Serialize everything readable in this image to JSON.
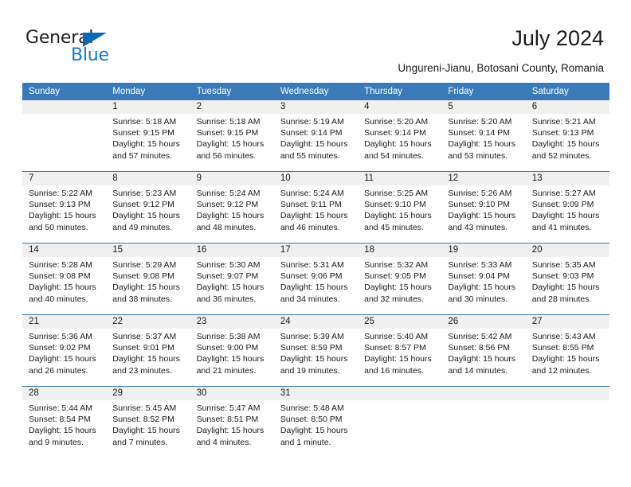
{
  "brand": {
    "name_part1": "General",
    "name_part2": "Blue",
    "triangle_icon": "triangle-icon",
    "accent_color": "#1878c4"
  },
  "header": {
    "title": "July 2024",
    "location": "Ungureni-Jianu, Botosani County, Romania"
  },
  "theme": {
    "header_blue": "#3a7ab8",
    "daynum_band": "#f0f0f0",
    "text": "#1a1a1a"
  },
  "calendar": {
    "weekday_headers": [
      "Sunday",
      "Monday",
      "Tuesday",
      "Wednesday",
      "Thursday",
      "Friday",
      "Saturday"
    ],
    "weeks": [
      {
        "days": [
          {
            "num": "",
            "lines": []
          },
          {
            "num": "1",
            "lines": [
              "Sunrise: 5:18 AM",
              "Sunset: 9:15 PM",
              "Daylight: 15 hours",
              "and 57 minutes."
            ]
          },
          {
            "num": "2",
            "lines": [
              "Sunrise: 5:18 AM",
              "Sunset: 9:15 PM",
              "Daylight: 15 hours",
              "and 56 minutes."
            ]
          },
          {
            "num": "3",
            "lines": [
              "Sunrise: 5:19 AM",
              "Sunset: 9:14 PM",
              "Daylight: 15 hours",
              "and 55 minutes."
            ]
          },
          {
            "num": "4",
            "lines": [
              "Sunrise: 5:20 AM",
              "Sunset: 9:14 PM",
              "Daylight: 15 hours",
              "and 54 minutes."
            ]
          },
          {
            "num": "5",
            "lines": [
              "Sunrise: 5:20 AM",
              "Sunset: 9:14 PM",
              "Daylight: 15 hours",
              "and 53 minutes."
            ]
          },
          {
            "num": "6",
            "lines": [
              "Sunrise: 5:21 AM",
              "Sunset: 9:13 PM",
              "Daylight: 15 hours",
              "and 52 minutes."
            ]
          }
        ]
      },
      {
        "days": [
          {
            "num": "7",
            "lines": [
              "Sunrise: 5:22 AM",
              "Sunset: 9:13 PM",
              "Daylight: 15 hours",
              "and 50 minutes."
            ]
          },
          {
            "num": "8",
            "lines": [
              "Sunrise: 5:23 AM",
              "Sunset: 9:12 PM",
              "Daylight: 15 hours",
              "and 49 minutes."
            ]
          },
          {
            "num": "9",
            "lines": [
              "Sunrise: 5:24 AM",
              "Sunset: 9:12 PM",
              "Daylight: 15 hours",
              "and 48 minutes."
            ]
          },
          {
            "num": "10",
            "lines": [
              "Sunrise: 5:24 AM",
              "Sunset: 9:11 PM",
              "Daylight: 15 hours",
              "and 46 minutes."
            ]
          },
          {
            "num": "11",
            "lines": [
              "Sunrise: 5:25 AM",
              "Sunset: 9:10 PM",
              "Daylight: 15 hours",
              "and 45 minutes."
            ]
          },
          {
            "num": "12",
            "lines": [
              "Sunrise: 5:26 AM",
              "Sunset: 9:10 PM",
              "Daylight: 15 hours",
              "and 43 minutes."
            ]
          },
          {
            "num": "13",
            "lines": [
              "Sunrise: 5:27 AM",
              "Sunset: 9:09 PM",
              "Daylight: 15 hours",
              "and 41 minutes."
            ]
          }
        ]
      },
      {
        "days": [
          {
            "num": "14",
            "lines": [
              "Sunrise: 5:28 AM",
              "Sunset: 9:08 PM",
              "Daylight: 15 hours",
              "and 40 minutes."
            ]
          },
          {
            "num": "15",
            "lines": [
              "Sunrise: 5:29 AM",
              "Sunset: 9:08 PM",
              "Daylight: 15 hours",
              "and 38 minutes."
            ]
          },
          {
            "num": "16",
            "lines": [
              "Sunrise: 5:30 AM",
              "Sunset: 9:07 PM",
              "Daylight: 15 hours",
              "and 36 minutes."
            ]
          },
          {
            "num": "17",
            "lines": [
              "Sunrise: 5:31 AM",
              "Sunset: 9:06 PM",
              "Daylight: 15 hours",
              "and 34 minutes."
            ]
          },
          {
            "num": "18",
            "lines": [
              "Sunrise: 5:32 AM",
              "Sunset: 9:05 PM",
              "Daylight: 15 hours",
              "and 32 minutes."
            ]
          },
          {
            "num": "19",
            "lines": [
              "Sunrise: 5:33 AM",
              "Sunset: 9:04 PM",
              "Daylight: 15 hours",
              "and 30 minutes."
            ]
          },
          {
            "num": "20",
            "lines": [
              "Sunrise: 5:35 AM",
              "Sunset: 9:03 PM",
              "Daylight: 15 hours",
              "and 28 minutes."
            ]
          }
        ]
      },
      {
        "days": [
          {
            "num": "21",
            "lines": [
              "Sunrise: 5:36 AM",
              "Sunset: 9:02 PM",
              "Daylight: 15 hours",
              "and 26 minutes."
            ]
          },
          {
            "num": "22",
            "lines": [
              "Sunrise: 5:37 AM",
              "Sunset: 9:01 PM",
              "Daylight: 15 hours",
              "and 23 minutes."
            ]
          },
          {
            "num": "23",
            "lines": [
              "Sunrise: 5:38 AM",
              "Sunset: 9:00 PM",
              "Daylight: 15 hours",
              "and 21 minutes."
            ]
          },
          {
            "num": "24",
            "lines": [
              "Sunrise: 5:39 AM",
              "Sunset: 8:59 PM",
              "Daylight: 15 hours",
              "and 19 minutes."
            ]
          },
          {
            "num": "25",
            "lines": [
              "Sunrise: 5:40 AM",
              "Sunset: 8:57 PM",
              "Daylight: 15 hours",
              "and 16 minutes."
            ]
          },
          {
            "num": "26",
            "lines": [
              "Sunrise: 5:42 AM",
              "Sunset: 8:56 PM",
              "Daylight: 15 hours",
              "and 14 minutes."
            ]
          },
          {
            "num": "27",
            "lines": [
              "Sunrise: 5:43 AM",
              "Sunset: 8:55 PM",
              "Daylight: 15 hours",
              "and 12 minutes."
            ]
          }
        ]
      },
      {
        "days": [
          {
            "num": "28",
            "lines": [
              "Sunrise: 5:44 AM",
              "Sunset: 8:54 PM",
              "Daylight: 15 hours",
              "and 9 minutes."
            ]
          },
          {
            "num": "29",
            "lines": [
              "Sunrise: 5:45 AM",
              "Sunset: 8:52 PM",
              "Daylight: 15 hours",
              "and 7 minutes."
            ]
          },
          {
            "num": "30",
            "lines": [
              "Sunrise: 5:47 AM",
              "Sunset: 8:51 PM",
              "Daylight: 15 hours",
              "and 4 minutes."
            ]
          },
          {
            "num": "31",
            "lines": [
              "Sunrise: 5:48 AM",
              "Sunset: 8:50 PM",
              "Daylight: 15 hours",
              "and 1 minute."
            ]
          },
          {
            "num": "",
            "lines": []
          },
          {
            "num": "",
            "lines": []
          },
          {
            "num": "",
            "lines": []
          }
        ]
      }
    ]
  }
}
